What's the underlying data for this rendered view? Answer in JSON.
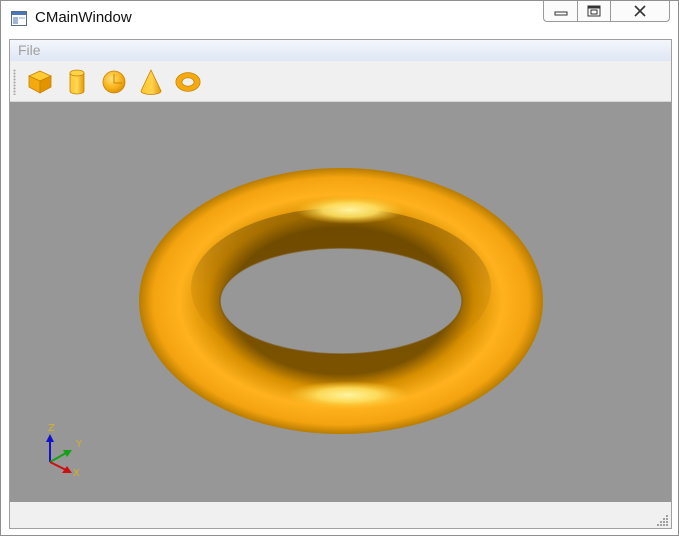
{
  "window": {
    "title": "CMainWindow"
  },
  "caption": {
    "minimize": "minimize-icon",
    "maximize": "maximize-icon",
    "close": "close-icon"
  },
  "menu": {
    "items": [
      {
        "label": "File"
      }
    ]
  },
  "toolbar": {
    "tools": [
      {
        "name": "box",
        "icon": "box-icon"
      },
      {
        "name": "cylinder",
        "icon": "cylinder-icon"
      },
      {
        "name": "sphere",
        "icon": "sphere-icon"
      },
      {
        "name": "cone",
        "icon": "cone-icon"
      },
      {
        "name": "torus",
        "icon": "torus-icon"
      }
    ]
  },
  "viewer": {
    "background": "#979797",
    "shape": "torus",
    "shape_color": "#f4a90f",
    "axes": {
      "x": "X",
      "y": "Y",
      "z": "Z"
    },
    "axis_colors": {
      "x": "#cc1010",
      "y": "#13a213",
      "z": "#1111cc",
      "label": "#d8b020"
    }
  },
  "statusbar": {
    "text": ""
  }
}
